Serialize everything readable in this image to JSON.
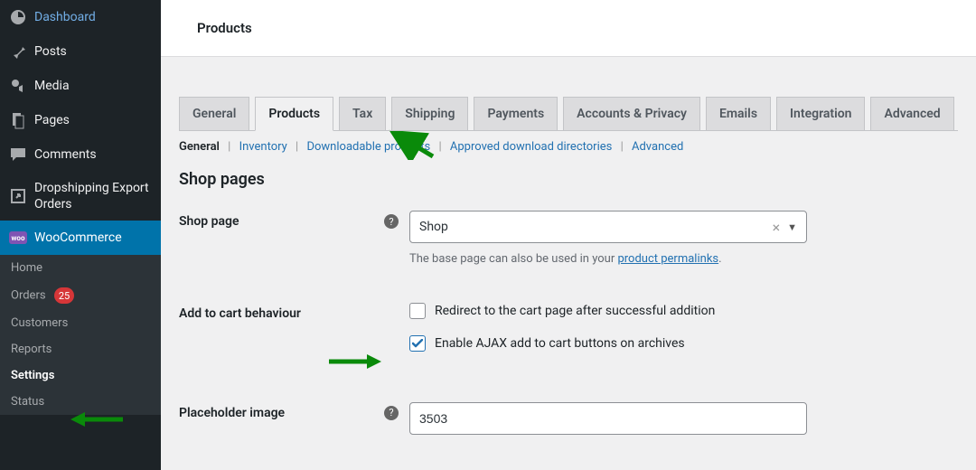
{
  "sidebar": {
    "items": [
      {
        "label": "Dashboard",
        "icon": "dashboard-icon"
      },
      {
        "label": "Posts",
        "icon": "pin-icon"
      },
      {
        "label": "Media",
        "icon": "media-icon"
      },
      {
        "label": "Pages",
        "icon": "page-icon"
      },
      {
        "label": "Comments",
        "icon": "comment-icon"
      },
      {
        "label": "Dropshipping Export Orders",
        "icon": "export-icon"
      },
      {
        "label": "WooCommerce",
        "icon": "woo-icon",
        "active": true
      }
    ],
    "submenu": [
      {
        "label": "Home"
      },
      {
        "label": "Orders",
        "badge": "25"
      },
      {
        "label": "Customers"
      },
      {
        "label": "Reports"
      },
      {
        "label": "Settings",
        "active": true
      },
      {
        "label": "Status"
      }
    ]
  },
  "header": {
    "title": "Products"
  },
  "tabs": [
    {
      "label": "General"
    },
    {
      "label": "Products",
      "active": true
    },
    {
      "label": "Tax"
    },
    {
      "label": "Shipping"
    },
    {
      "label": "Payments"
    },
    {
      "label": "Accounts & Privacy"
    },
    {
      "label": "Emails"
    },
    {
      "label": "Integration"
    },
    {
      "label": "Advanced"
    }
  ],
  "subnav": [
    {
      "label": "General",
      "current": true
    },
    {
      "label": "Inventory"
    },
    {
      "label": "Downloadable products"
    },
    {
      "label": "Approved download directories"
    },
    {
      "label": "Advanced"
    }
  ],
  "section": {
    "title": "Shop pages"
  },
  "fields": {
    "shop_page": {
      "label": "Shop page",
      "value": "Shop",
      "desc_prefix": "The base page can also be used in your ",
      "desc_link": "product permalinks",
      "desc_suffix": "."
    },
    "add_to_cart": {
      "label": "Add to cart behaviour",
      "opt1": "Redirect to the cart page after successful addition",
      "opt2": "Enable AJAX add to cart buttons on archives"
    },
    "placeholder": {
      "label": "Placeholder image",
      "value": "3503"
    }
  }
}
